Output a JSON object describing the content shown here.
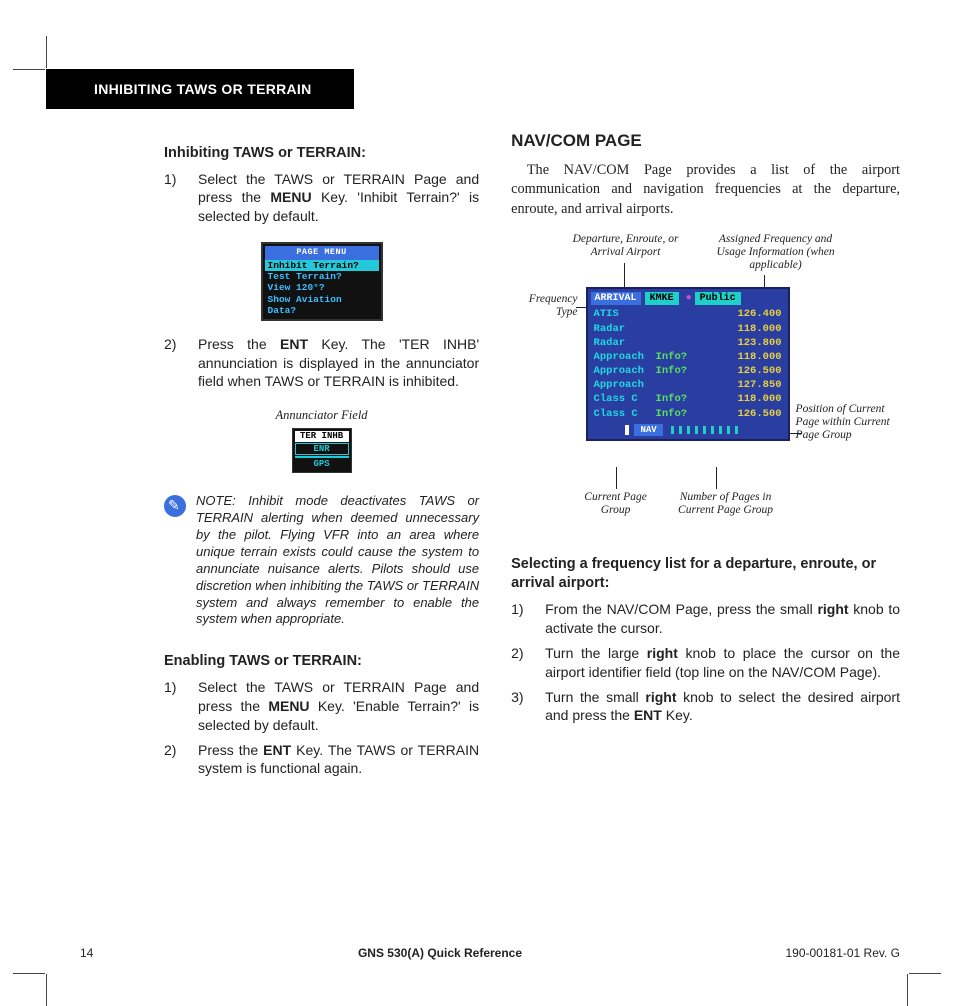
{
  "header": {
    "tab": "INHIBITING TAWS OR TERRAIN"
  },
  "left": {
    "h1": "Inhibiting TAWS or TERRAIN:",
    "step1a": "Select the TAWS or TERRAIN Page and press the ",
    "step1key": "MENU",
    "step1b": " Key.  'Inhibit Terrain?' is selected by default.",
    "menu": {
      "title": "PAGE MENU",
      "opt1": "Inhibit Terrain?",
      "opt2": "Test Terrain?",
      "opt3": "View 120°?",
      "opt4": "Show Aviation Data?"
    },
    "step2a": "Press the ",
    "step2key": "ENT",
    "step2b": " Key.  The 'TER INHB' annunciation is displayed in the annunciator field when TAWS or TERRAIN is inhibited.",
    "annCaption": "Annunciator Field",
    "ann": {
      "r1": "TER INHB",
      "r2": "ENR",
      "r3": " ",
      "r4": "GPS"
    },
    "note": "NOTE:  Inhibit mode deactivates TAWS or TERRAIN alerting when deemed unnecessary by the pilot.  Flying VFR into an area where unique terrain exists could cause the system to annunciate nuisance alerts.  Pilots should use discretion when inhibiting the TAWS or TERRAIN system and always remember to enable the system when appropriate.",
    "h2": "Enabling TAWS or TERRAIN:",
    "en1a": "Select the TAWS or TERRAIN Page and press the ",
    "en1key": "MENU",
    "en1b": " Key.  'Enable Terrain?' is selected by default.",
    "en2a": "Press the ",
    "en2key": "ENT",
    "en2b": " Key.  The TAWS or TERRAIN system is functional again."
  },
  "right": {
    "pageTitle": "NAV/COM PAGE",
    "intro": "The NAV/COM Page provides a list of the airport communication and navigation frequencies at the departure, enroute, and arrival airports.",
    "callouts": {
      "dep": "Departure, Enroute, or Arrival Airport",
      "freq": "Frequency Type",
      "assigned": "Assigned Frequency and Usage Information (when applicable)",
      "pos": "Position of Current Page within Current Page Group",
      "curgrp": "Current Page Group",
      "numpg": "Number of Pages in Current Page Group"
    },
    "screen": {
      "hdrLabel": "ARRIVAL",
      "hdrId": "KMKE",
      "hdrPub": "Public",
      "rows": [
        {
          "c1": "ATIS",
          "c2": "",
          "c3": "126.400"
        },
        {
          "c1": "Radar",
          "c2": "",
          "c3": "118.000"
        },
        {
          "c1": "Radar",
          "c2": "",
          "c3": "123.800"
        },
        {
          "c1": "Approach",
          "c2": "Info?",
          "c3": "118.000"
        },
        {
          "c1": "Approach",
          "c2": "Info?",
          "c3": "126.500"
        },
        {
          "c1": "Approach",
          "c2": "",
          "c3": "127.850"
        },
        {
          "c1": "Class C",
          "c2": "Info?",
          "c3": "118.000"
        },
        {
          "c1": "Class C",
          "c2": "Info?",
          "c3": "126.500"
        }
      ],
      "navLabel": "NAV"
    },
    "h1": "Selecting a frequency list for a departure, enroute, or arrival airport:",
    "s1a": "From the NAV/COM Page, press the small ",
    "s1k": "right",
    "s1b": " knob to activate the cursor.",
    "s2a": "Turn the large ",
    "s2k": "right",
    "s2b": " knob to place the cursor on the airport identifier field (top line on the NAV/COM Page).",
    "s3a": "Turn the small ",
    "s3k": "right",
    "s3b": " knob to select the desired airport and press the ",
    "s3k2": "ENT",
    "s3c": " Key."
  },
  "footer": {
    "page": "14",
    "title": "GNS 530(A) Quick Reference",
    "rev": "190-00181-01  Rev. G"
  }
}
